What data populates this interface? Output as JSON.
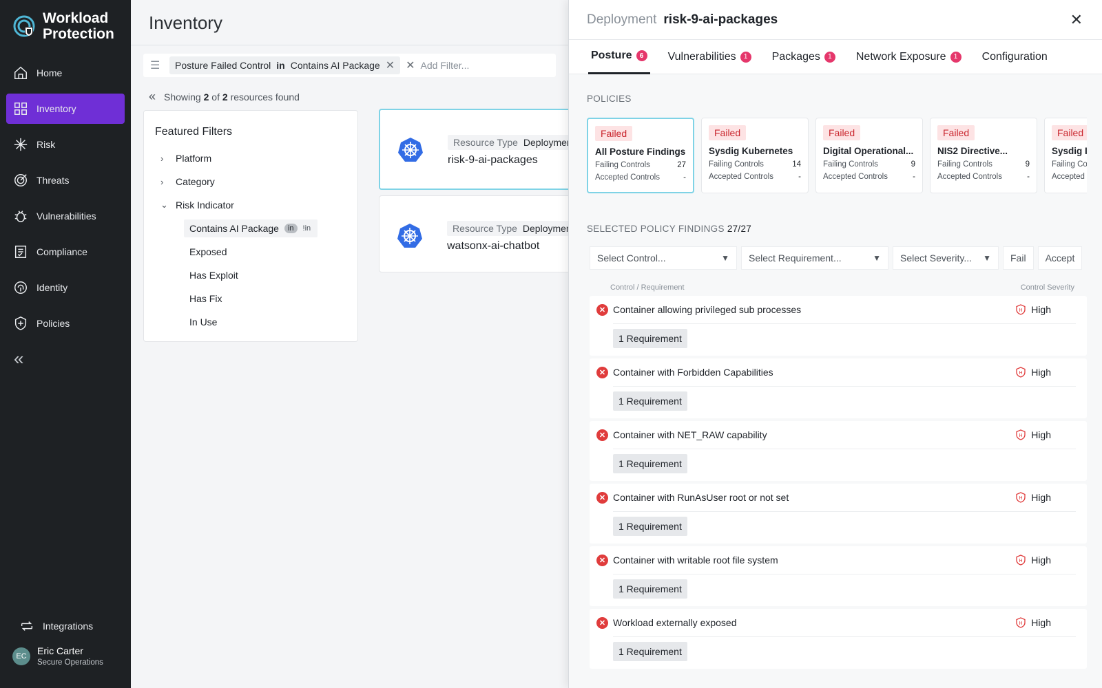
{
  "app": {
    "name_line1": "Workload",
    "name_line2": "Protection"
  },
  "nav": {
    "items": [
      {
        "label": "Home"
      },
      {
        "label": "Inventory"
      },
      {
        "label": "Risk"
      },
      {
        "label": "Threats"
      },
      {
        "label": "Vulnerabilities"
      },
      {
        "label": "Compliance"
      },
      {
        "label": "Identity"
      },
      {
        "label": "Policies"
      }
    ],
    "collapse_glyph": "«",
    "integrations": "Integrations"
  },
  "user": {
    "initials": "EC",
    "name": "Eric Carter",
    "role": "Secure Operations"
  },
  "page": {
    "title": "Inventory"
  },
  "filter": {
    "field": "Posture Failed Control",
    "operator": "in",
    "value": "Contains AI Package",
    "placeholder": "Add Filter..."
  },
  "results": {
    "prefix": "Showing",
    "shown": "2",
    "of": "of",
    "total": "2",
    "suffix": "resources found"
  },
  "featured": {
    "title": "Featured Filters",
    "groups": [
      {
        "label": "Platform"
      },
      {
        "label": "Category"
      },
      {
        "label": "Risk Indicator"
      }
    ],
    "risk_items": [
      {
        "label": "Contains AI Package",
        "in": "in",
        "notin": "!in"
      },
      {
        "label": "Exposed"
      },
      {
        "label": "Has Exploit"
      },
      {
        "label": "Has Fix"
      },
      {
        "label": "In Use"
      }
    ]
  },
  "resources": [
    {
      "type_label": "Resource Type",
      "type": "Deployment",
      "name": "risk-9-ai-packages"
    },
    {
      "type_label": "Resource Type",
      "type": "Deployment",
      "name": "watsonx-ai-chatbot"
    }
  ],
  "panel": {
    "kind": "Deployment",
    "name": "risk-9-ai-packages",
    "tabs": [
      {
        "label": "Posture",
        "badge": "6"
      },
      {
        "label": "Vulnerabilities",
        "badge": "1"
      },
      {
        "label": "Packages",
        "badge": "1"
      },
      {
        "label": "Network Exposure",
        "badge": "1"
      },
      {
        "label": "Configuration"
      }
    ],
    "policies_label": "POLICIES",
    "policies": [
      {
        "status": "Failed",
        "name": "All Posture Findings",
        "failing_label": "Failing Controls",
        "failing": "27",
        "accepted_label": "Accepted Controls",
        "accepted": "-"
      },
      {
        "status": "Failed",
        "name": "Sysdig Kubernetes",
        "failing_label": "Failing Controls",
        "failing": "14",
        "accepted_label": "Accepted Controls",
        "accepted": "-"
      },
      {
        "status": "Failed",
        "name": "Digital Operational...",
        "failing_label": "Failing Controls",
        "failing": "9",
        "accepted_label": "Accepted Controls",
        "accepted": "-"
      },
      {
        "status": "Failed",
        "name": "NIS2 Directive...",
        "failing_label": "Failing Controls",
        "failing": "9",
        "accepted_label": "Accepted Controls",
        "accepted": "-"
      },
      {
        "status": "Failed",
        "name": "Sysdig IE",
        "failing_label": "Failing Cor",
        "failing": "",
        "accepted_label": "Accepted (",
        "accepted": ""
      }
    ],
    "findings_label": "SELECTED POLICY FINDINGS",
    "findings_count": "27/27",
    "select_control": "Select Control...",
    "select_requirement": "Select Requirement...",
    "select_severity": "Select Severity...",
    "fail_btn": "Fail",
    "accept_btn": "Accept",
    "col_control": "Control / Requirement",
    "col_severity": "Control Severity",
    "findings": [
      {
        "title": "Container allowing privileged sub processes",
        "severity": "High",
        "requirement": "1 Requirement"
      },
      {
        "title": "Container with Forbidden Capabilities",
        "severity": "High",
        "requirement": "1 Requirement"
      },
      {
        "title": "Container with NET_RAW capability",
        "severity": "High",
        "requirement": "1 Requirement"
      },
      {
        "title": "Container with RunAsUser root or not set",
        "severity": "High",
        "requirement": "1 Requirement"
      },
      {
        "title": "Container with writable root file system",
        "severity": "High",
        "requirement": "1 Requirement"
      },
      {
        "title": "Workload externally exposed",
        "severity": "High",
        "requirement": "1 Requirement"
      }
    ]
  }
}
